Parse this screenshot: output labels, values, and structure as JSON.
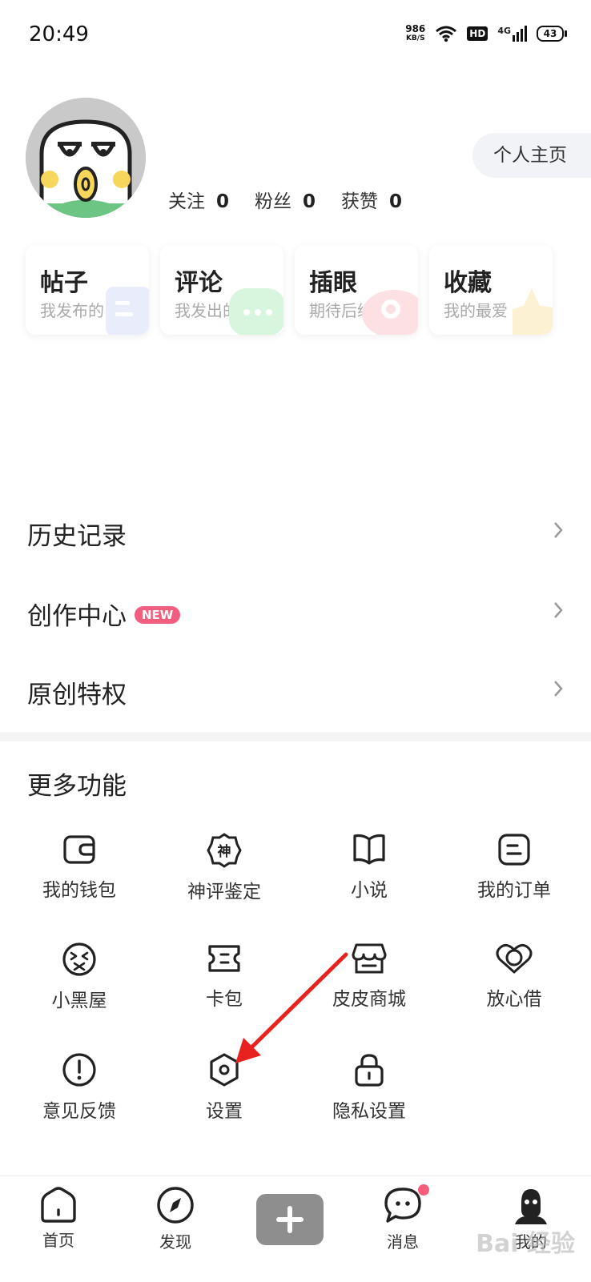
{
  "status_bar": {
    "time": "20:49",
    "net_speed": "986",
    "net_unit": "KB/S",
    "hd": "HD",
    "network": "4G",
    "battery": "43"
  },
  "profile": {
    "home_button": "个人主页",
    "stats": [
      {
        "label": "关注",
        "value": "0"
      },
      {
        "label": "粉丝",
        "value": "0"
      },
      {
        "label": "获赞",
        "value": "0"
      }
    ]
  },
  "cards": [
    {
      "title": "帖子",
      "subtitle": "我发布的",
      "color": "#e8ecfb"
    },
    {
      "title": "评论",
      "subtitle": "我发出的",
      "color": "#d8f5de"
    },
    {
      "title": "插眼",
      "subtitle": "期待后续",
      "color": "#fde0e4"
    },
    {
      "title": "收藏",
      "subtitle": "我的最爱",
      "color": "#fdf1d4"
    }
  ],
  "menu": {
    "history": "历史记录",
    "creator": "创作中心",
    "creator_badge": "NEW",
    "original": "原创特权"
  },
  "more": {
    "title": "更多功能",
    "items": [
      {
        "label": "我的钱包",
        "icon": "wallet-icon"
      },
      {
        "label": "神评鉴定",
        "icon": "badge-icon"
      },
      {
        "label": "小说",
        "icon": "book-icon"
      },
      {
        "label": "我的订单",
        "icon": "order-icon"
      },
      {
        "label": "小黑屋",
        "icon": "dizzy-face-icon"
      },
      {
        "label": "卡包",
        "icon": "ticket-icon"
      },
      {
        "label": "皮皮商城",
        "icon": "store-icon"
      },
      {
        "label": "放心借",
        "icon": "loan-icon"
      },
      {
        "label": "意见反馈",
        "icon": "exclamation-icon"
      },
      {
        "label": "设置",
        "icon": "hexagon-settings-icon"
      },
      {
        "label": "隐私设置",
        "icon": "lock-icon"
      }
    ],
    "badge_char": "神"
  },
  "nav": {
    "home": "首页",
    "discover": "发现",
    "messages": "消息",
    "mine": "我的"
  },
  "watermark": "Bai 经验",
  "accent": "#f25e7d"
}
